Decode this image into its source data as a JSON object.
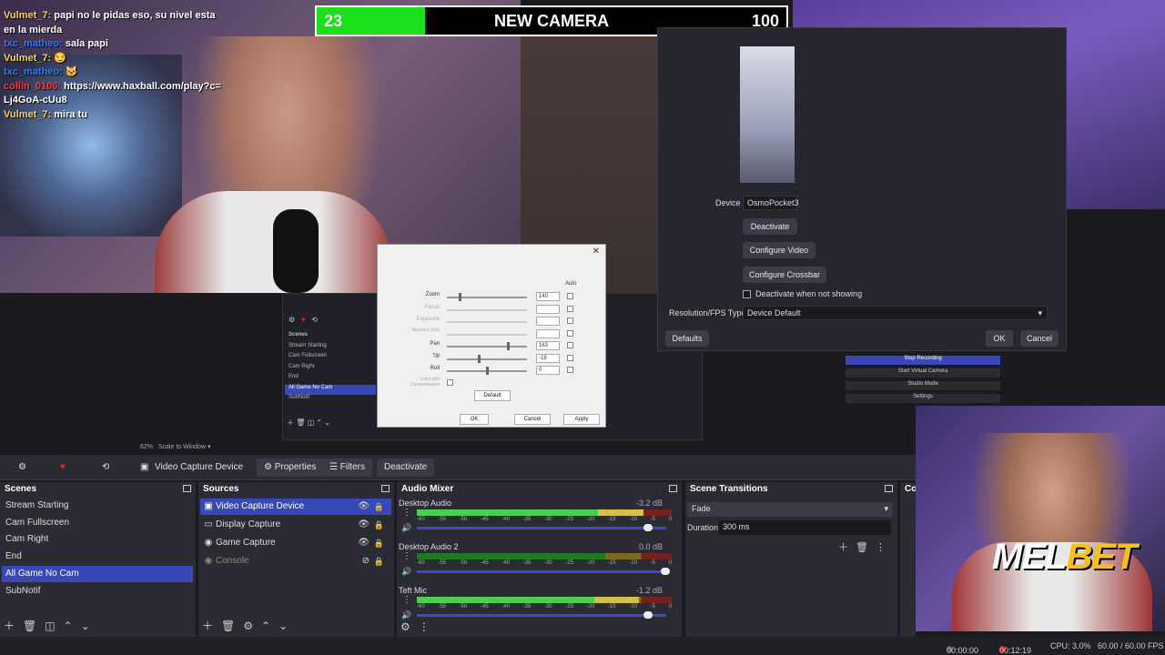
{
  "chat": {
    "lines": [
      {
        "user": "Vulmet_7:",
        "text": "papi no le pidas eso, su nivel esta en la mierda"
      },
      {
        "user": "txc_matheo:",
        "text": "sala papi"
      },
      {
        "user": "Vulmet_7:",
        "text": ""
      },
      {
        "user": "txc_matheo:",
        "text": ""
      },
      {
        "user": "collin_0106:",
        "text": "https://www.haxball.com/play?c=Lj4GoA-cUu8"
      },
      {
        "user": "Vulmet_7:",
        "text": "mira tu"
      }
    ]
  },
  "banner": {
    "left_count": "23",
    "title": "NEW CAMERA",
    "right_count": "100",
    "progress": 0.23,
    "fill_color": "#19e019"
  },
  "brand": {
    "mel": "MEL",
    "bet": "BET"
  },
  "properties": {
    "device_label": "Device",
    "device_value": "OsmoPocket3",
    "deactivate": "Deactivate",
    "configure_video": "Configure Video",
    "configure_crossbar": "Configure Crossbar",
    "deactivate_when_not_showing": "Deactivate when not showing",
    "res_label": "Resolution/FPS Type",
    "res_value": "Device Default",
    "defaults": "Defaults",
    "ok": "OK",
    "cancel": "Cancel"
  },
  "camera_control": {
    "auto_label": "Auto",
    "rows": [
      {
        "name": "Zoom",
        "value": "140",
        "enabled": true,
        "pos": 0.15
      },
      {
        "name": "Focus",
        "value": "",
        "enabled": false,
        "pos": 0.0
      },
      {
        "name": "Exposure",
        "value": "",
        "enabled": false,
        "pos": 0.0
      },
      {
        "name": "Aperture (Iris)",
        "value": "",
        "enabled": false,
        "pos": 0.0
      },
      {
        "name": "Pan",
        "value": "163",
        "enabled": true,
        "pos": 0.78
      },
      {
        "name": "Tilt",
        "value": "-18",
        "enabled": true,
        "pos": 0.4
      },
      {
        "name": "Roll",
        "value": "0",
        "enabled": true,
        "pos": 0.5
      },
      {
        "name": "Low Light Compensation",
        "value": "",
        "enabled": false,
        "pos": -1
      }
    ],
    "default_btn": "Default",
    "ok": "OK",
    "cancel": "Cancel",
    "apply": "Apply"
  },
  "mini_obs": {
    "scenes_label": "Scenes",
    "scenes": [
      "Stream Starting",
      "Cam Fullscreen",
      "Cam Right",
      "End",
      "All Game No Cam",
      "SubNotif"
    ],
    "stop_recording": "Stop Recording",
    "start_virtual_camera": "Start Virtual Camera",
    "studio_mode": "Studio Mode",
    "settings": "Settings",
    "zoom_text": "62%",
    "scale_text": "Scale to Window"
  },
  "toolbar": {
    "source_name": "Video Capture Device",
    "properties": "Properties",
    "filters": "Filters",
    "deactivate": "Deactivate"
  },
  "scenes": {
    "title": "Scenes",
    "items": [
      "Stream Starting",
      "Cam Fullscreen",
      "Cam Right",
      "End",
      "All Game No Cam",
      "SubNotif"
    ],
    "selected_index": 4
  },
  "sources": {
    "title": "Sources",
    "items": [
      {
        "name": "Video Capture Device",
        "icon": "camera-icon",
        "visible": true
      },
      {
        "name": "Display Capture",
        "icon": "monitor-icon",
        "visible": true
      },
      {
        "name": "Game Capture",
        "icon": "gamepad-icon",
        "visible": true
      },
      {
        "name": "Console",
        "icon": "gamepad-icon",
        "visible": false
      }
    ]
  },
  "mixer": {
    "title": "Audio Mixer",
    "channels": [
      {
        "name": "Desktop Audio",
        "db": "-3.2 dB",
        "level": 0.89,
        "volume": 0.93
      },
      {
        "name": "Desktop Audio 2",
        "db": "0.0 dB",
        "level": 0.0,
        "volume": 1.0
      },
      {
        "name": "Teft Mic",
        "db": "-1.2 dB",
        "level": 0.87,
        "volume": 0.93
      }
    ],
    "ticks": [
      "-60",
      "-55",
      "-50",
      "-45",
      "-40",
      "-35",
      "-30",
      "-25",
      "-20",
      "-15",
      "-10",
      "-5",
      "0"
    ]
  },
  "transitions": {
    "title": "Scene Transitions",
    "selected": "Fade",
    "duration_label": "Duration",
    "duration_value": "300 ms"
  },
  "controls": {
    "title": "Co"
  },
  "status": {
    "stream_time": "00:00:00",
    "rec_time": "00:12:19",
    "cpu": "CPU: 3.0%",
    "fps": "60.00 / 60.00 FPS"
  }
}
